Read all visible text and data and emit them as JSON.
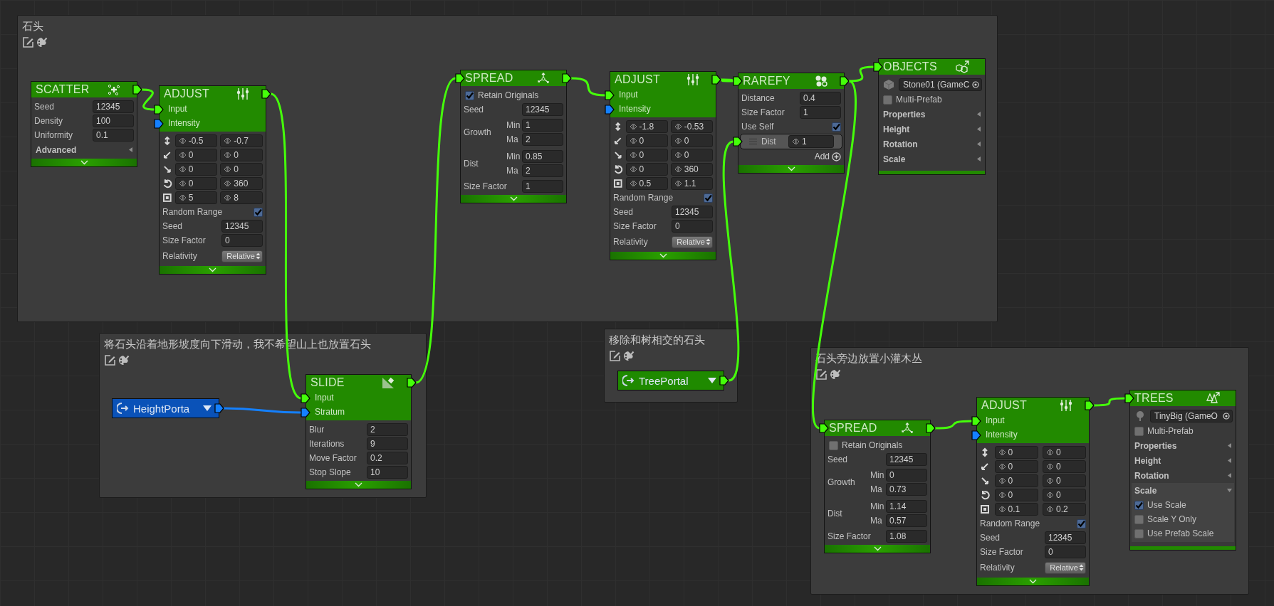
{
  "groups": [
    {
      "title": "石头"
    },
    {
      "title": "将石头沿着地形坡度向下滑动，我不希望山上也放置石头"
    },
    {
      "title": "移除和树相交的石头"
    },
    {
      "title": "石头旁边放置小灌木丛"
    }
  ],
  "nodes": [
    {
      "kind": "scatter",
      "title": "SCATTER",
      "output": {
        "color": "#45ff0a"
      },
      "collapsible": true,
      "rows": [
        {
          "kind": "field",
          "label": "Seed",
          "value": "12345"
        },
        {
          "kind": "field",
          "label": "Density",
          "value": "100"
        },
        {
          "kind": "field",
          "label": "Uniformity",
          "value": "0.1"
        },
        {
          "kind": "foldout",
          "label": "Advanced",
          "expanded": false
        }
      ]
    },
    {
      "kind": "adjust",
      "title": "ADJUST",
      "output": {
        "color": "#45ff0a"
      },
      "collapsible": true,
      "inputs": [
        {
          "label": "Input",
          "color": "#45ff0a"
        },
        {
          "label": "Intensity",
          "color": "#1480ff"
        }
      ],
      "rows": [
        {
          "kind": "range",
          "min": "-0.5",
          "max": "-0.7"
        },
        {
          "kind": "range",
          "min": "0",
          "max": "0"
        },
        {
          "kind": "range",
          "min": "0",
          "max": "0"
        },
        {
          "kind": "range",
          "min": "0",
          "max": "360"
        },
        {
          "kind": "range",
          "min": "5",
          "max": "8"
        },
        {
          "kind": "check",
          "label": "Random Range",
          "checked": true
        },
        {
          "kind": "field",
          "label": "Seed",
          "value": "12345"
        },
        {
          "kind": "field",
          "label": "Size Factor",
          "value": "0"
        },
        {
          "kind": "dropdown",
          "label": "Relativity",
          "value": "Relative"
        }
      ]
    },
    {
      "kind": "spread",
      "title": "SPREAD",
      "header_port": {
        "color": "#45ff0a"
      },
      "output": {
        "color": "#45ff0a"
      },
      "collapsible": true,
      "rows": [
        {
          "kind": "checkleft",
          "label": "Retain Originals",
          "checked": true
        },
        {
          "kind": "field",
          "label": "Seed",
          "value": "12345"
        },
        {
          "kind": "minmax",
          "label": "Growth",
          "min_label": "Min",
          "min": "1",
          "max_label": "Ma",
          "max": "2"
        },
        {
          "kind": "minmax",
          "label": "Dist",
          "min_label": "Min",
          "min": "0.85",
          "max_label": "Ma",
          "max": "2"
        },
        {
          "kind": "field",
          "label": "Size Factor",
          "value": "1"
        }
      ]
    },
    {
      "kind": "adjust",
      "title": "ADJUST",
      "output": {
        "color": "#45ff0a"
      },
      "collapsible": true,
      "inputs": [
        {
          "label": "Input",
          "color": "#45ff0a"
        },
        {
          "label": "Intensity",
          "color": "#1480ff"
        }
      ],
      "rows": [
        {
          "kind": "range",
          "min": "-1.8",
          "max": "-0.53"
        },
        {
          "kind": "range",
          "min": "0",
          "max": "0"
        },
        {
          "kind": "range",
          "min": "0",
          "max": "0"
        },
        {
          "kind": "range",
          "min": "0",
          "max": "360"
        },
        {
          "kind": "range",
          "min": "0.5",
          "max": "1.1"
        },
        {
          "kind": "check",
          "label": "Random Range",
          "checked": true
        },
        {
          "kind": "field",
          "label": "Seed",
          "value": "12345"
        },
        {
          "kind": "field",
          "label": "Size Factor",
          "value": "0"
        },
        {
          "kind": "dropdown",
          "label": "Relativity",
          "value": "Relative"
        }
      ]
    },
    {
      "kind": "rarefy",
      "title": "RAREFY",
      "header_port": {
        "color": "#45ff0a"
      },
      "output": {
        "color": "#45ff0a"
      },
      "collapsible": true,
      "rows": [
        {
          "kind": "field",
          "label": "Distance",
          "value": "0.4"
        },
        {
          "kind": "field",
          "label": "Size Factor",
          "value": "1"
        },
        {
          "kind": "check",
          "label": "Use Self",
          "checked": true
        },
        {
          "kind": "port_field",
          "label": "Dist",
          "value": "1",
          "port": {
            "color": "#45ff0a"
          }
        },
        {
          "kind": "add",
          "label": "Add"
        }
      ]
    },
    {
      "kind": "objects",
      "title": "OBJECTS",
      "header_port": {
        "color": "#45ff0a"
      },
      "collapsible": false,
      "rows": [
        {
          "kind": "object",
          "value": "Stone01 (GameC"
        },
        {
          "kind": "checkleft",
          "label": "Multi-Prefab",
          "checked": false
        },
        {
          "kind": "foldout",
          "label": "Properties",
          "expanded": false
        },
        {
          "kind": "foldout",
          "label": "Height",
          "expanded": false
        },
        {
          "kind": "foldout",
          "label": "Rotation",
          "expanded": false
        },
        {
          "kind": "foldout",
          "label": "Scale",
          "expanded": false
        }
      ]
    },
    {
      "kind": "portal",
      "title": "HeightPorta",
      "color": "#0a52b8",
      "output": {
        "color": "#1480ff"
      }
    },
    {
      "kind": "slide",
      "title": "SLIDE",
      "output": {
        "color": "#45ff0a"
      },
      "collapsible": true,
      "inputs": [
        {
          "label": "Input",
          "color": "#45ff0a"
        },
        {
          "label": "Stratum",
          "color": "#1480ff"
        }
      ],
      "rows": [
        {
          "kind": "field",
          "label": "Blur",
          "value": "2"
        },
        {
          "kind": "field",
          "label": "Iterations",
          "value": "9"
        },
        {
          "kind": "field",
          "label": "Move Factor",
          "value": "0.2"
        },
        {
          "kind": "field",
          "label": "Stop Slope",
          "value": "10"
        }
      ]
    },
    {
      "kind": "portal",
      "title": "TreePortal",
      "color": "#1f8a00",
      "output": {
        "color": "#45ff0a"
      }
    },
    {
      "kind": "spread",
      "title": "SPREAD",
      "header_port": {
        "color": "#45ff0a"
      },
      "output": {
        "color": "#45ff0a"
      },
      "collapsible": true,
      "rows": [
        {
          "kind": "checkleft",
          "label": "Retain Originals",
          "checked": false
        },
        {
          "kind": "field",
          "label": "Seed",
          "value": "12345"
        },
        {
          "kind": "minmax",
          "label": "Growth",
          "min_label": "Min",
          "min": "0",
          "max_label": "Ma",
          "max": "0.73"
        },
        {
          "kind": "minmax",
          "label": "Dist",
          "min_label": "Min",
          "min": "1.14",
          "max_label": "Ma",
          "max": "0.57"
        },
        {
          "kind": "field",
          "label": "Size Factor",
          "value": "1.08"
        }
      ]
    },
    {
      "kind": "adjust",
      "title": "ADJUST",
      "output": {
        "color": "#45ff0a"
      },
      "collapsible": true,
      "inputs": [
        {
          "label": "Input",
          "color": "#45ff0a"
        },
        {
          "label": "Intensity",
          "color": "#1480ff"
        }
      ],
      "rows": [
        {
          "kind": "range",
          "min": "0",
          "max": "0"
        },
        {
          "kind": "range",
          "min": "0",
          "max": "0"
        },
        {
          "kind": "range",
          "min": "0",
          "max": "0"
        },
        {
          "kind": "range",
          "min": "0",
          "max": "0"
        },
        {
          "kind": "range",
          "min": "0.1",
          "max": "0.2"
        },
        {
          "kind": "check",
          "label": "Random Range",
          "checked": true
        },
        {
          "kind": "field",
          "label": "Seed",
          "value": "12345"
        },
        {
          "kind": "field",
          "label": "Size Factor",
          "value": "0"
        },
        {
          "kind": "dropdown",
          "label": "Relativity",
          "value": "Relative"
        }
      ]
    },
    {
      "kind": "trees",
      "title": "TREES",
      "header_port": {
        "color": "#45ff0a"
      },
      "collapsible": false,
      "rows": [
        {
          "kind": "object",
          "value": "TinyBig (GameO"
        },
        {
          "kind": "checkleft",
          "label": "Multi-Prefab",
          "checked": false
        },
        {
          "kind": "foldout",
          "label": "Properties",
          "expanded": false
        },
        {
          "kind": "foldout",
          "label": "Height",
          "expanded": false
        },
        {
          "kind": "foldout",
          "label": "Rotation",
          "expanded": false
        },
        {
          "kind": "foldout",
          "label": "Scale",
          "expanded": true,
          "children": [
            {
              "kind": "checkleft",
              "label": "Use Scale",
              "checked": true
            },
            {
              "kind": "checkleft",
              "label": "Scale Y Only",
              "checked": false
            },
            {
              "kind": "checkleft",
              "label": "Use Prefab Scale",
              "checked": false
            }
          ]
        }
      ]
    }
  ]
}
